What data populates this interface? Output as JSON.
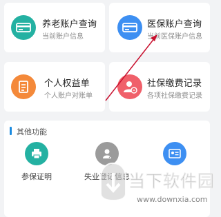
{
  "cards": [
    {
      "title": "养老账户查询",
      "subtitle": "当前账户信息",
      "icon": "pension-card-icon",
      "color": "#24b1a2"
    },
    {
      "title": "医保账户查询",
      "subtitle": "当前医保账户信息",
      "icon": "medical-card-icon",
      "color": "#3d8ff2"
    },
    {
      "title": "个人权益单",
      "subtitle": "个人账户对账单",
      "icon": "statement-icon",
      "color": "#f4893a"
    },
    {
      "title": "社保缴费记录",
      "subtitle": "各项社保缴费记录",
      "icon": "payment-record-icon",
      "color": "#f0606a"
    }
  ],
  "section": {
    "title": "其他功能",
    "items": [
      {
        "label": "参保证明",
        "icon": "printer-icon",
        "color": "#24b1a2"
      },
      {
        "label": "失业登记信息",
        "icon": "person-edit-icon",
        "color": "#9b9b9b"
      },
      {
        "label": "",
        "icon": "id-card-icon",
        "color": "#3d8ff2"
      }
    ]
  },
  "watermark": {
    "brand": "当下软件园",
    "url": "www.downxia.com"
  },
  "colors": {
    "accent": "#1b8be0",
    "arrow": "#c8102e"
  }
}
